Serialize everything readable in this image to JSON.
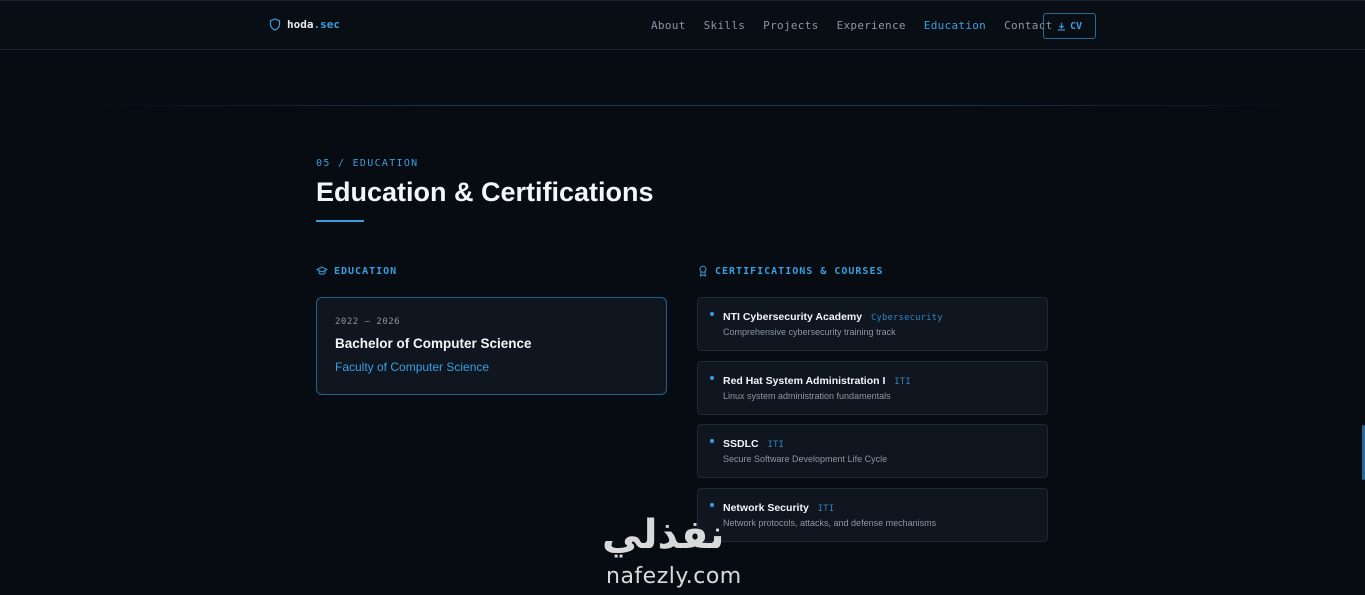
{
  "nav": {
    "logo_name": "hoda",
    "logo_accent": ".sec",
    "links": [
      {
        "label": "About",
        "active": false
      },
      {
        "label": "Skills",
        "active": false
      },
      {
        "label": "Projects",
        "active": false
      },
      {
        "label": "Experience",
        "active": false
      },
      {
        "label": "Education",
        "active": true
      },
      {
        "label": "Contact",
        "active": false
      }
    ],
    "cv_label": "CV"
  },
  "section": {
    "tag": "05 / EDUCATION",
    "title": "Education & Certifications"
  },
  "education": {
    "heading": "EDUCATION",
    "card": {
      "years": "2022 – 2026",
      "degree": "Bachelor of Computer Science",
      "faculty": "Faculty of Computer Science"
    }
  },
  "certifications": {
    "heading": "CERTIFICATIONS & COURSES",
    "items": [
      {
        "title": "NTI Cybersecurity Academy",
        "tag": "Cybersecurity",
        "desc": "Comprehensive cybersecurity training track"
      },
      {
        "title": "Red Hat System Administration I",
        "tag": "ITI",
        "desc": "Linux system administration fundamentals"
      },
      {
        "title": "SSDLC",
        "tag": "ITI",
        "desc": "Secure Software Development Life Cycle"
      },
      {
        "title": "Network Security",
        "tag": "ITI",
        "desc": "Network protocols, attacks, and defense mechanisms"
      }
    ]
  },
  "watermark": {
    "arabic": "نفذلي",
    "latin": "nafezly.com"
  },
  "colors": {
    "accent": "#3b9ede",
    "background": "#070b12",
    "card": "#0f1620"
  }
}
